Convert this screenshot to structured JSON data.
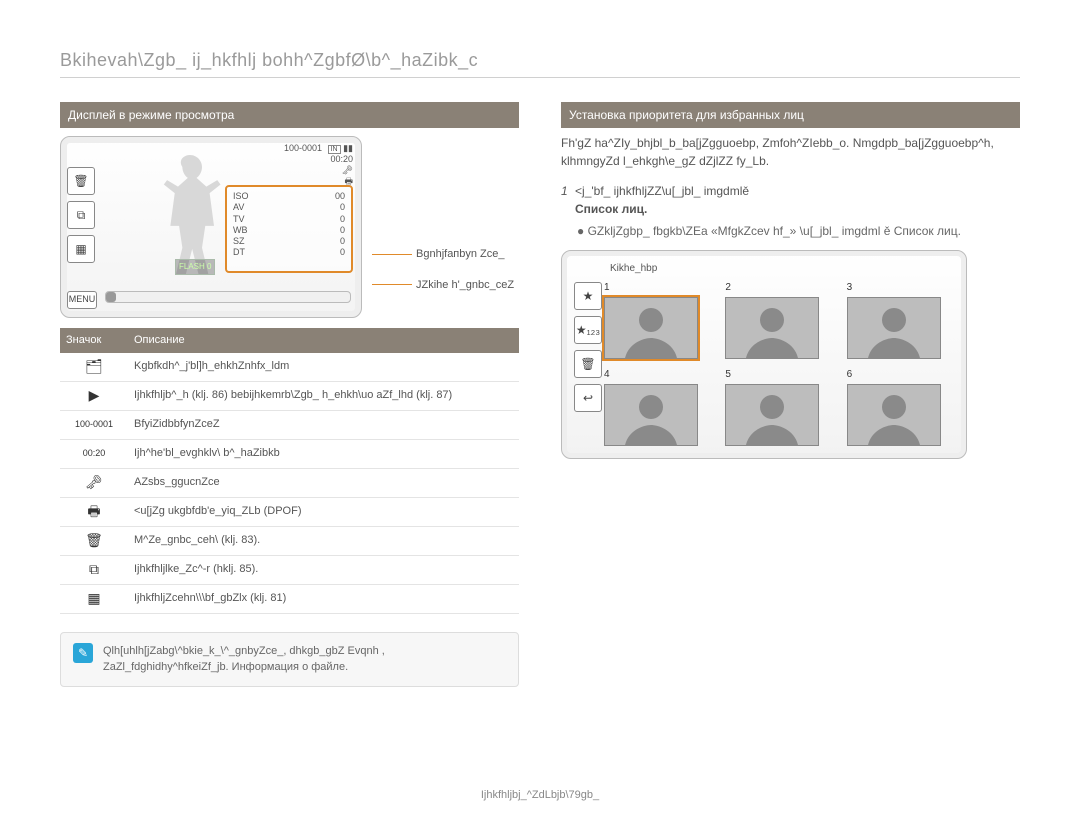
{
  "page_title": "Bkihevah\\Zgb_ ij_hkfhlj bohh^ZgbfØ\\b^_haZibk_c",
  "left": {
    "section_title": "Дисплей в режиме просмотра",
    "display": {
      "file_no": "100-0001",
      "time": "00:20",
      "card_icon": "IN",
      "battery_icon": "batt",
      "lock_icon": "🗝",
      "print_icon": "🖶",
      "flash_label": "FLASH 0",
      "menu_label": "MENU",
      "tag_rows": [
        [
          "ISO",
          "00"
        ],
        [
          "AV",
          "0"
        ],
        [
          "TV",
          "0"
        ],
        [
          "WB",
          "0"
        ],
        [
          "SZ",
          "0"
        ],
        [
          "DT",
          "0"
        ]
      ],
      "callout1": "Bgnhjfапbyn Zce_",
      "callout2": "JZkihe h'_gnbc_ceZ"
    },
    "table": {
      "h1": "Значок",
      "h2": "Описание",
      "rows": [
        {
          "icon": "🗂",
          "desc": "Kgbfkdh^_j'bl]h_ehkhZnhfx_ldm"
        },
        {
          "icon": "▶",
          "desc": "Ijhkfhljb^_h (klj. 86) bebijhkemrb\\Zgb_ h_ehkh\\uo aZf_lhd (klj. 87)"
        },
        {
          "icon_text": "100-0001",
          "desc": "BfyiZidbbfynZceZ"
        },
        {
          "icon_text": "00:20",
          "desc": "Ijh^he'bl_evghklv\\ b^_haZibkb"
        },
        {
          "icon": "🗝",
          "desc": "AZsbs_ggucnZce"
        },
        {
          "icon": "🖶",
          "desc": "<u[jZg ukgbfdb'e_yiq_ZLb (DPOF)"
        },
        {
          "icon": "🗑",
          "desc": "M^Ze_gnbc_ceh\\ (klj. 83)."
        },
        {
          "icon": "⧉",
          "desc": "Ijhkfhljlke_Zc^-r (hklj. 85)."
        },
        {
          "icon": "▦",
          "desc": "IjhkfhljZcehn\\\\\\bf_gbZlx (klj. 81)"
        }
      ]
    },
    "note": "Qlh[uhlh[jZabg\\^bkie_k_\\^_gnbyZce_, dhkgb_gbZ Evqnh , ZaZl_fdghidhy^hfkeiZf_jb. Информация о файле."
  },
  "right": {
    "section_title": "Установка приоритета для избранных лиц",
    "para": "Fh'gZ ha^ZIy_bhjbl_b_ba[jZgguoebp, Zmfoh^ZIebb_o. Nmgdpb_ba[jZgguoebp^h, klhmngyZd l_ehkgh\\e_gZ dZjlZZ fy_Lb.",
    "step1_lead": "<j_'bf_ ijhkfhljZZ\\u[_jbl_ imgdmlě",
    "step1_tail": "Список лиц.",
    "step2": "GZkljZgbp_ fbgkb\\ZEа «MfgkZcev hf_» \\u[_jbl_ imgdml ě Список лиц.",
    "card": {
      "label": "Kikhe_hbp",
      "side": [
        "★",
        "★₁₂₃",
        "🗑",
        "↩"
      ],
      "cells": [
        1,
        2,
        3,
        4,
        5,
        6
      ]
    }
  },
  "footer": "Ijhkfhljbj_^ZdLbjb\\79gb_",
  "colors": {
    "accent": "#e08a2a",
    "bar": "#8a8176"
  }
}
